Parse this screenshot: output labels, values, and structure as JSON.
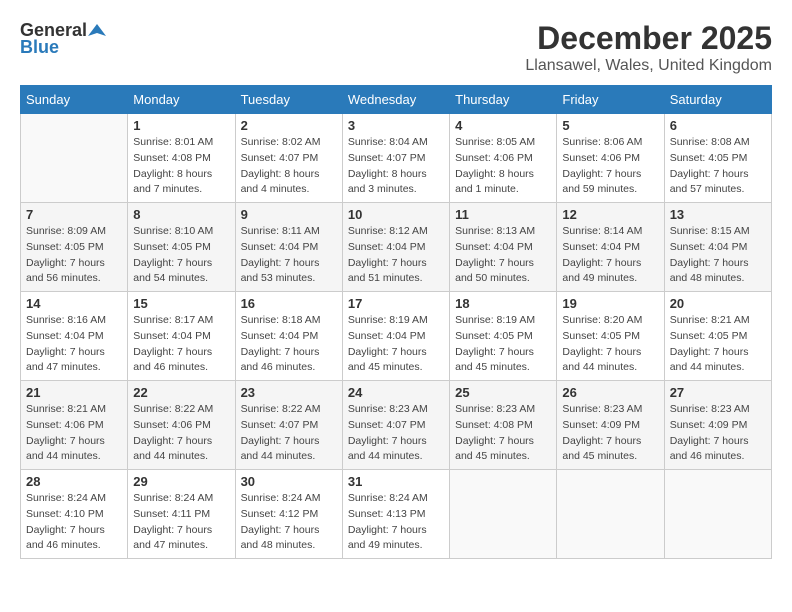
{
  "header": {
    "logo_general": "General",
    "logo_blue": "Blue",
    "month_title": "December 2025",
    "location": "Llansawel, Wales, United Kingdom"
  },
  "calendar": {
    "days_of_week": [
      "Sunday",
      "Monday",
      "Tuesday",
      "Wednesday",
      "Thursday",
      "Friday",
      "Saturday"
    ],
    "weeks": [
      [
        {
          "day": "",
          "info": ""
        },
        {
          "day": "1",
          "info": "Sunrise: 8:01 AM\nSunset: 4:08 PM\nDaylight: 8 hours\nand 7 minutes."
        },
        {
          "day": "2",
          "info": "Sunrise: 8:02 AM\nSunset: 4:07 PM\nDaylight: 8 hours\nand 4 minutes."
        },
        {
          "day": "3",
          "info": "Sunrise: 8:04 AM\nSunset: 4:07 PM\nDaylight: 8 hours\nand 3 minutes."
        },
        {
          "day": "4",
          "info": "Sunrise: 8:05 AM\nSunset: 4:06 PM\nDaylight: 8 hours\nand 1 minute."
        },
        {
          "day": "5",
          "info": "Sunrise: 8:06 AM\nSunset: 4:06 PM\nDaylight: 7 hours\nand 59 minutes."
        },
        {
          "day": "6",
          "info": "Sunrise: 8:08 AM\nSunset: 4:05 PM\nDaylight: 7 hours\nand 57 minutes."
        }
      ],
      [
        {
          "day": "7",
          "info": "Sunrise: 8:09 AM\nSunset: 4:05 PM\nDaylight: 7 hours\nand 56 minutes."
        },
        {
          "day": "8",
          "info": "Sunrise: 8:10 AM\nSunset: 4:05 PM\nDaylight: 7 hours\nand 54 minutes."
        },
        {
          "day": "9",
          "info": "Sunrise: 8:11 AM\nSunset: 4:04 PM\nDaylight: 7 hours\nand 53 minutes."
        },
        {
          "day": "10",
          "info": "Sunrise: 8:12 AM\nSunset: 4:04 PM\nDaylight: 7 hours\nand 51 minutes."
        },
        {
          "day": "11",
          "info": "Sunrise: 8:13 AM\nSunset: 4:04 PM\nDaylight: 7 hours\nand 50 minutes."
        },
        {
          "day": "12",
          "info": "Sunrise: 8:14 AM\nSunset: 4:04 PM\nDaylight: 7 hours\nand 49 minutes."
        },
        {
          "day": "13",
          "info": "Sunrise: 8:15 AM\nSunset: 4:04 PM\nDaylight: 7 hours\nand 48 minutes."
        }
      ],
      [
        {
          "day": "14",
          "info": "Sunrise: 8:16 AM\nSunset: 4:04 PM\nDaylight: 7 hours\nand 47 minutes."
        },
        {
          "day": "15",
          "info": "Sunrise: 8:17 AM\nSunset: 4:04 PM\nDaylight: 7 hours\nand 46 minutes."
        },
        {
          "day": "16",
          "info": "Sunrise: 8:18 AM\nSunset: 4:04 PM\nDaylight: 7 hours\nand 46 minutes."
        },
        {
          "day": "17",
          "info": "Sunrise: 8:19 AM\nSunset: 4:04 PM\nDaylight: 7 hours\nand 45 minutes."
        },
        {
          "day": "18",
          "info": "Sunrise: 8:19 AM\nSunset: 4:05 PM\nDaylight: 7 hours\nand 45 minutes."
        },
        {
          "day": "19",
          "info": "Sunrise: 8:20 AM\nSunset: 4:05 PM\nDaylight: 7 hours\nand 44 minutes."
        },
        {
          "day": "20",
          "info": "Sunrise: 8:21 AM\nSunset: 4:05 PM\nDaylight: 7 hours\nand 44 minutes."
        }
      ],
      [
        {
          "day": "21",
          "info": "Sunrise: 8:21 AM\nSunset: 4:06 PM\nDaylight: 7 hours\nand 44 minutes."
        },
        {
          "day": "22",
          "info": "Sunrise: 8:22 AM\nSunset: 4:06 PM\nDaylight: 7 hours\nand 44 minutes."
        },
        {
          "day": "23",
          "info": "Sunrise: 8:22 AM\nSunset: 4:07 PM\nDaylight: 7 hours\nand 44 minutes."
        },
        {
          "day": "24",
          "info": "Sunrise: 8:23 AM\nSunset: 4:07 PM\nDaylight: 7 hours\nand 44 minutes."
        },
        {
          "day": "25",
          "info": "Sunrise: 8:23 AM\nSunset: 4:08 PM\nDaylight: 7 hours\nand 45 minutes."
        },
        {
          "day": "26",
          "info": "Sunrise: 8:23 AM\nSunset: 4:09 PM\nDaylight: 7 hours\nand 45 minutes."
        },
        {
          "day": "27",
          "info": "Sunrise: 8:23 AM\nSunset: 4:09 PM\nDaylight: 7 hours\nand 46 minutes."
        }
      ],
      [
        {
          "day": "28",
          "info": "Sunrise: 8:24 AM\nSunset: 4:10 PM\nDaylight: 7 hours\nand 46 minutes."
        },
        {
          "day": "29",
          "info": "Sunrise: 8:24 AM\nSunset: 4:11 PM\nDaylight: 7 hours\nand 47 minutes."
        },
        {
          "day": "30",
          "info": "Sunrise: 8:24 AM\nSunset: 4:12 PM\nDaylight: 7 hours\nand 48 minutes."
        },
        {
          "day": "31",
          "info": "Sunrise: 8:24 AM\nSunset: 4:13 PM\nDaylight: 7 hours\nand 49 minutes."
        },
        {
          "day": "",
          "info": ""
        },
        {
          "day": "",
          "info": ""
        },
        {
          "day": "",
          "info": ""
        }
      ]
    ]
  }
}
